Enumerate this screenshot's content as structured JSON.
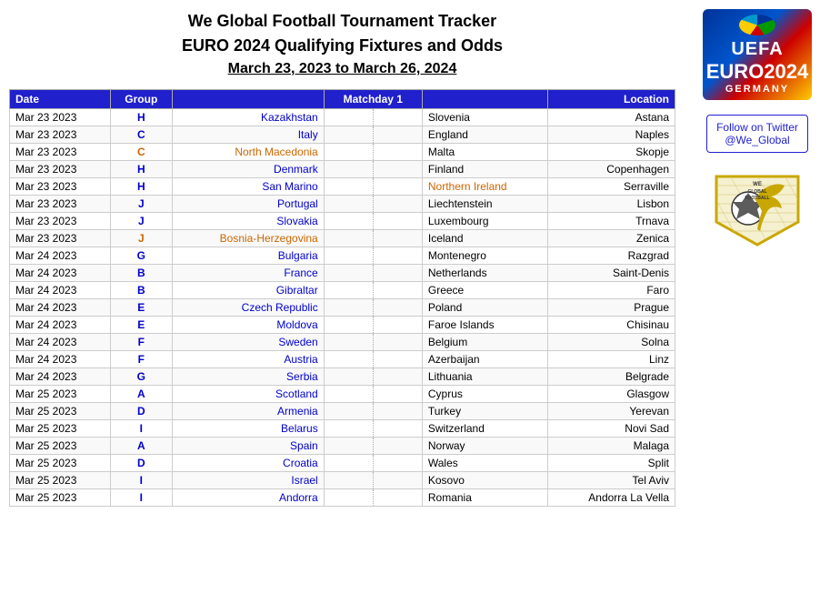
{
  "header": {
    "line1": "We Global Football Tournament Tracker",
    "line2": "EURO 2024 Qualifying Fixtures and Odds",
    "line3": "March 23, 2023 to March 26, 2024"
  },
  "table": {
    "columns": [
      "Date",
      "Group",
      "Matchday 1",
      "",
      "Location"
    ],
    "col_headers": {
      "date": "Date",
      "group": "Group",
      "matchday": "Matchday 1",
      "location": "Location"
    },
    "rows": [
      {
        "date": "Mar 23 2023",
        "group": "H",
        "home": "Kazakhstan",
        "away": "Slovenia",
        "location": "Astana",
        "home_color": "blue",
        "away_color": "black"
      },
      {
        "date": "Mar 23 2023",
        "group": "C",
        "home": "Italy",
        "away": "England",
        "location": "Naples",
        "home_color": "blue",
        "away_color": "black"
      },
      {
        "date": "Mar 23 2023",
        "group": "C",
        "home": "North Macedonia",
        "away": "Malta",
        "location": "Skopje",
        "home_color": "orange",
        "away_color": "black"
      },
      {
        "date": "Mar 23 2023",
        "group": "H",
        "home": "Denmark",
        "away": "Finland",
        "location": "Copenhagen",
        "home_color": "blue",
        "away_color": "black"
      },
      {
        "date": "Mar 23 2023",
        "group": "H",
        "home": "San Marino",
        "away": "Northern Ireland",
        "location": "Serraville",
        "home_color": "blue",
        "away_color": "orange"
      },
      {
        "date": "Mar 23 2023",
        "group": "J",
        "home": "Portugal",
        "away": "Liechtenstein",
        "location": "Lisbon",
        "home_color": "blue",
        "away_color": "black"
      },
      {
        "date": "Mar 23 2023",
        "group": "J",
        "home": "Slovakia",
        "away": "Luxembourg",
        "location": "Trnava",
        "home_color": "blue",
        "away_color": "black"
      },
      {
        "date": "Mar 23 2023",
        "group": "J",
        "home": "Bosnia-Herzegovina",
        "away": "Iceland",
        "location": "Zenica",
        "home_color": "orange",
        "away_color": "black"
      },
      {
        "date": "Mar 24 2023",
        "group": "G",
        "home": "Bulgaria",
        "away": "Montenegro",
        "location": "Razgrad",
        "home_color": "blue",
        "away_color": "black"
      },
      {
        "date": "Mar 24 2023",
        "group": "B",
        "home": "France",
        "away": "Netherlands",
        "location": "Saint-Denis",
        "home_color": "blue",
        "away_color": "black"
      },
      {
        "date": "Mar 24 2023",
        "group": "B",
        "home": "Gibraltar",
        "away": "Greece",
        "location": "Faro",
        "home_color": "blue",
        "away_color": "black"
      },
      {
        "date": "Mar 24 2023",
        "group": "E",
        "home": "Czech Republic",
        "away": "Poland",
        "location": "Prague",
        "home_color": "blue",
        "away_color": "black"
      },
      {
        "date": "Mar 24 2023",
        "group": "E",
        "home": "Moldova",
        "away": "Faroe Islands",
        "location": "Chisinau",
        "home_color": "blue",
        "away_color": "black"
      },
      {
        "date": "Mar 24 2023",
        "group": "F",
        "home": "Sweden",
        "away": "Belgium",
        "location": "Solna",
        "home_color": "blue",
        "away_color": "black"
      },
      {
        "date": "Mar 24 2023",
        "group": "F",
        "home": "Austria",
        "away": "Azerbaijan",
        "location": "Linz",
        "home_color": "blue",
        "away_color": "black"
      },
      {
        "date": "Mar 24 2023",
        "group": "G",
        "home": "Serbia",
        "away": "Lithuania",
        "location": "Belgrade",
        "home_color": "blue",
        "away_color": "black"
      },
      {
        "date": "Mar 25 2023",
        "group": "A",
        "home": "Scotland",
        "away": "Cyprus",
        "location": "Glasgow",
        "home_color": "blue",
        "away_color": "black"
      },
      {
        "date": "Mar 25 2023",
        "group": "D",
        "home": "Armenia",
        "away": "Turkey",
        "location": "Yerevan",
        "home_color": "blue",
        "away_color": "black"
      },
      {
        "date": "Mar 25 2023",
        "group": "I",
        "home": "Belarus",
        "away": "Switzerland",
        "location": "Novi Sad",
        "home_color": "blue",
        "away_color": "black"
      },
      {
        "date": "Mar 25 2023",
        "group": "A",
        "home": "Spain",
        "away": "Norway",
        "location": "Malaga",
        "home_color": "blue",
        "away_color": "black"
      },
      {
        "date": "Mar 25 2023",
        "group": "D",
        "home": "Croatia",
        "away": "Wales",
        "location": "Split",
        "home_color": "blue",
        "away_color": "black"
      },
      {
        "date": "Mar 25 2023",
        "group": "I",
        "home": "Israel",
        "away": "Kosovo",
        "location": "Tel Aviv",
        "home_color": "blue",
        "away_color": "black"
      },
      {
        "date": "Mar 25 2023",
        "group": "I",
        "home": "Andorra",
        "away": "Romania",
        "location": "Andorra La Vella",
        "home_color": "blue",
        "away_color": "black"
      }
    ]
  },
  "sidebar": {
    "twitter_label": "Follow on Twitter",
    "twitter_handle": "@We_Global",
    "euro_logo": {
      "line1": "UEFA",
      "line2": "EURO2024",
      "line3": "GERMANY"
    }
  }
}
